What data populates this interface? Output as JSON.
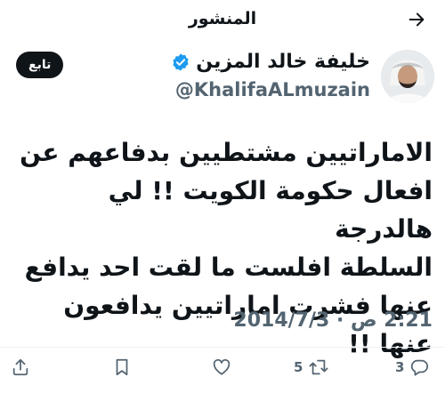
{
  "header": {
    "title": "المنشور"
  },
  "author": {
    "display_name": "خليفة خالد المزين",
    "handle": "@KhalifaALmuzain",
    "verified": true,
    "follow_label": "تابع"
  },
  "tweet": {
    "text": "الاماراتيين مشتطيين بدفاعهم عن\nافعال حكومة الكويت !! لي هالدرجة\nالسلطة افلست ما لقت احد يدافع\nعنها فشرت اماراتيين يدافعون عنها !!",
    "timestamp": "2:21 ص · 2014/7/3"
  },
  "actions": {
    "replies": "3",
    "retweets": "5",
    "likes": "",
    "bookmarks": ""
  },
  "colors": {
    "text": "#0f1419",
    "secondary": "#536471",
    "verified": "#1d9bf0",
    "follow_bg": "#0f1419"
  },
  "icons": [
    "arrow-right-icon",
    "verified-badge-icon",
    "reply-icon",
    "retweet-icon",
    "like-icon",
    "bookmark-icon",
    "share-icon"
  ]
}
